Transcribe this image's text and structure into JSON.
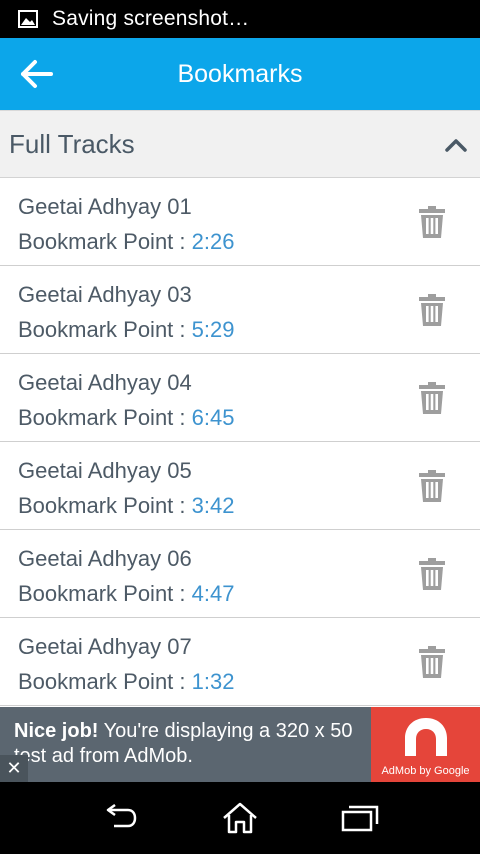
{
  "status_bar": {
    "text": "Saving screenshot…",
    "icon": "image-icon"
  },
  "app_bar": {
    "title": "Bookmarks",
    "back_icon": "arrow-left-icon"
  },
  "section": {
    "label": "Full Tracks",
    "toggle_icon": "chevron-up-icon"
  },
  "bookmarks": [
    {
      "name": "Geetai Adhyay 01",
      "point_label": "Bookmark Point : ",
      "time": "2:26"
    },
    {
      "name": "Geetai Adhyay 03",
      "point_label": "Bookmark Point : ",
      "time": "5:29"
    },
    {
      "name": "Geetai Adhyay 04",
      "point_label": "Bookmark Point : ",
      "time": "6:45"
    },
    {
      "name": "Geetai Adhyay 05",
      "point_label": "Bookmark Point : ",
      "time": "3:42"
    },
    {
      "name": "Geetai Adhyay 06",
      "point_label": "Bookmark Point : ",
      "time": "4:47"
    },
    {
      "name": "Geetai Adhyay 07",
      "point_label": "Bookmark Point : ",
      "time": "1:32"
    }
  ],
  "ad": {
    "headline": "Nice job!",
    "body": " You're displaying a 320 x 50 test ad from AdMob.",
    "brand": "AdMob by Google",
    "close": "✕"
  },
  "nav": {
    "back_icon": "back-icon",
    "home_icon": "home-icon",
    "recents_icon": "recents-icon"
  },
  "colors": {
    "accent": "#0ca6ea",
    "time_text": "#3d93cf",
    "ad_red": "#e5453a"
  }
}
